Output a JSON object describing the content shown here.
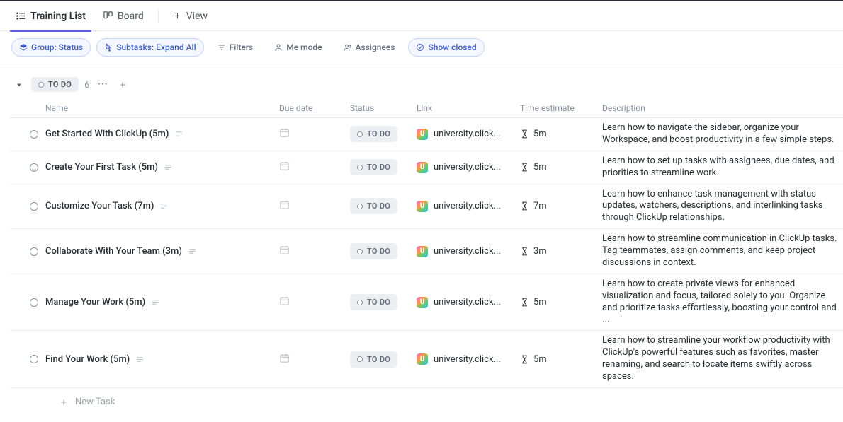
{
  "tabs": {
    "training_list": "Training List",
    "board": "Board",
    "add_view": "View"
  },
  "filters": {
    "group": "Group: Status",
    "subtasks": "Subtasks: Expand All",
    "filters": "Filters",
    "me_mode": "Me mode",
    "assignees": "Assignees",
    "show_closed": "Show closed"
  },
  "group": {
    "status_label": "TO DO",
    "count": "6"
  },
  "columns": {
    "name": "Name",
    "due_date": "Due date",
    "status": "Status",
    "link": "Link",
    "time_estimate": "Time estimate",
    "description": "Description"
  },
  "common": {
    "status_badge": "TO DO",
    "link_text": "university.click...",
    "u_glyph": "U"
  },
  "tasks": [
    {
      "name": "Get Started With ClickUp (5m)",
      "time": "5m",
      "description": "Learn how to navigate the sidebar, organize your Workspace, and boost productivity in a few simple steps."
    },
    {
      "name": "Create Your First Task (5m)",
      "time": "5m",
      "description": "Learn how to set up tasks with assignees, due dates, and priorities to streamline work."
    },
    {
      "name": "Customize Your Task (7m)",
      "time": "7m",
      "description": "Learn how to enhance task management with status updates, watchers, descriptions, and interlinking tasks through ClickUp relationships."
    },
    {
      "name": "Collaborate With Your Team (3m)",
      "time": "3m",
      "description": "Learn how to streamline communication in ClickUp tasks. Tag teammates, assign comments, and keep project discussions in context."
    },
    {
      "name": "Manage Your Work (5m)",
      "time": "5m",
      "description": "Learn how to create private views for enhanced visualization and focus, tailored solely to you. Organize and prioritize tasks effortlessly, boosting your control and ..."
    },
    {
      "name": "Find Your Work (5m)",
      "time": "5m",
      "description": "Learn how to streamline your workflow productivity with ClickUp's powerful features such as favorites, master renaming, and search to locate items swiftly across spaces."
    }
  ],
  "new_task_label": "New Task"
}
